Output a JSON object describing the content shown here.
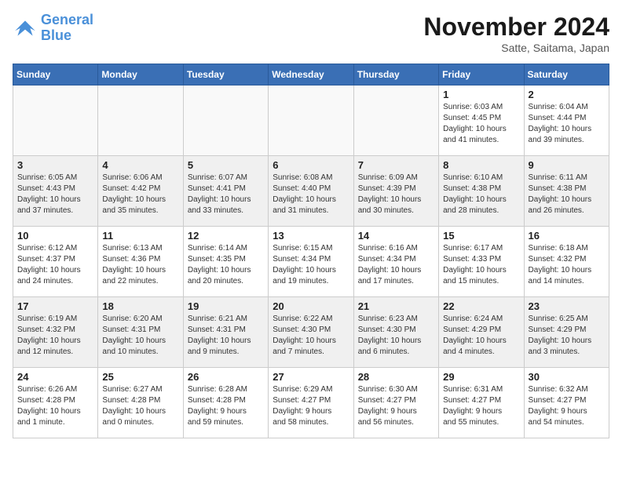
{
  "logo": {
    "line1": "General",
    "line2": "Blue"
  },
  "title": "November 2024",
  "subtitle": "Satte, Saitama, Japan",
  "headers": [
    "Sunday",
    "Monday",
    "Tuesday",
    "Wednesday",
    "Thursday",
    "Friday",
    "Saturday"
  ],
  "weeks": [
    [
      {
        "num": "",
        "info": "",
        "empty": true
      },
      {
        "num": "",
        "info": "",
        "empty": true
      },
      {
        "num": "",
        "info": "",
        "empty": true
      },
      {
        "num": "",
        "info": "",
        "empty": true
      },
      {
        "num": "",
        "info": "",
        "empty": true
      },
      {
        "num": "1",
        "info": "Sunrise: 6:03 AM\nSunset: 4:45 PM\nDaylight: 10 hours\nand 41 minutes."
      },
      {
        "num": "2",
        "info": "Sunrise: 6:04 AM\nSunset: 4:44 PM\nDaylight: 10 hours\nand 39 minutes."
      }
    ],
    [
      {
        "num": "3",
        "info": "Sunrise: 6:05 AM\nSunset: 4:43 PM\nDaylight: 10 hours\nand 37 minutes.",
        "gray": true
      },
      {
        "num": "4",
        "info": "Sunrise: 6:06 AM\nSunset: 4:42 PM\nDaylight: 10 hours\nand 35 minutes.",
        "gray": true
      },
      {
        "num": "5",
        "info": "Sunrise: 6:07 AM\nSunset: 4:41 PM\nDaylight: 10 hours\nand 33 minutes.",
        "gray": true
      },
      {
        "num": "6",
        "info": "Sunrise: 6:08 AM\nSunset: 4:40 PM\nDaylight: 10 hours\nand 31 minutes.",
        "gray": true
      },
      {
        "num": "7",
        "info": "Sunrise: 6:09 AM\nSunset: 4:39 PM\nDaylight: 10 hours\nand 30 minutes.",
        "gray": true
      },
      {
        "num": "8",
        "info": "Sunrise: 6:10 AM\nSunset: 4:38 PM\nDaylight: 10 hours\nand 28 minutes.",
        "gray": true
      },
      {
        "num": "9",
        "info": "Sunrise: 6:11 AM\nSunset: 4:38 PM\nDaylight: 10 hours\nand 26 minutes.",
        "gray": true
      }
    ],
    [
      {
        "num": "10",
        "info": "Sunrise: 6:12 AM\nSunset: 4:37 PM\nDaylight: 10 hours\nand 24 minutes."
      },
      {
        "num": "11",
        "info": "Sunrise: 6:13 AM\nSunset: 4:36 PM\nDaylight: 10 hours\nand 22 minutes."
      },
      {
        "num": "12",
        "info": "Sunrise: 6:14 AM\nSunset: 4:35 PM\nDaylight: 10 hours\nand 20 minutes."
      },
      {
        "num": "13",
        "info": "Sunrise: 6:15 AM\nSunset: 4:34 PM\nDaylight: 10 hours\nand 19 minutes."
      },
      {
        "num": "14",
        "info": "Sunrise: 6:16 AM\nSunset: 4:34 PM\nDaylight: 10 hours\nand 17 minutes."
      },
      {
        "num": "15",
        "info": "Sunrise: 6:17 AM\nSunset: 4:33 PM\nDaylight: 10 hours\nand 15 minutes."
      },
      {
        "num": "16",
        "info": "Sunrise: 6:18 AM\nSunset: 4:32 PM\nDaylight: 10 hours\nand 14 minutes."
      }
    ],
    [
      {
        "num": "17",
        "info": "Sunrise: 6:19 AM\nSunset: 4:32 PM\nDaylight: 10 hours\nand 12 minutes.",
        "gray": true
      },
      {
        "num": "18",
        "info": "Sunrise: 6:20 AM\nSunset: 4:31 PM\nDaylight: 10 hours\nand 10 minutes.",
        "gray": true
      },
      {
        "num": "19",
        "info": "Sunrise: 6:21 AM\nSunset: 4:31 PM\nDaylight: 10 hours\nand 9 minutes.",
        "gray": true
      },
      {
        "num": "20",
        "info": "Sunrise: 6:22 AM\nSunset: 4:30 PM\nDaylight: 10 hours\nand 7 minutes.",
        "gray": true
      },
      {
        "num": "21",
        "info": "Sunrise: 6:23 AM\nSunset: 4:30 PM\nDaylight: 10 hours\nand 6 minutes.",
        "gray": true
      },
      {
        "num": "22",
        "info": "Sunrise: 6:24 AM\nSunset: 4:29 PM\nDaylight: 10 hours\nand 4 minutes.",
        "gray": true
      },
      {
        "num": "23",
        "info": "Sunrise: 6:25 AM\nSunset: 4:29 PM\nDaylight: 10 hours\nand 3 minutes.",
        "gray": true
      }
    ],
    [
      {
        "num": "24",
        "info": "Sunrise: 6:26 AM\nSunset: 4:28 PM\nDaylight: 10 hours\nand 1 minute."
      },
      {
        "num": "25",
        "info": "Sunrise: 6:27 AM\nSunset: 4:28 PM\nDaylight: 10 hours\nand 0 minutes."
      },
      {
        "num": "26",
        "info": "Sunrise: 6:28 AM\nSunset: 4:28 PM\nDaylight: 9 hours\nand 59 minutes."
      },
      {
        "num": "27",
        "info": "Sunrise: 6:29 AM\nSunset: 4:27 PM\nDaylight: 9 hours\nand 58 minutes."
      },
      {
        "num": "28",
        "info": "Sunrise: 6:30 AM\nSunset: 4:27 PM\nDaylight: 9 hours\nand 56 minutes."
      },
      {
        "num": "29",
        "info": "Sunrise: 6:31 AM\nSunset: 4:27 PM\nDaylight: 9 hours\nand 55 minutes."
      },
      {
        "num": "30",
        "info": "Sunrise: 6:32 AM\nSunset: 4:27 PM\nDaylight: 9 hours\nand 54 minutes."
      }
    ]
  ]
}
